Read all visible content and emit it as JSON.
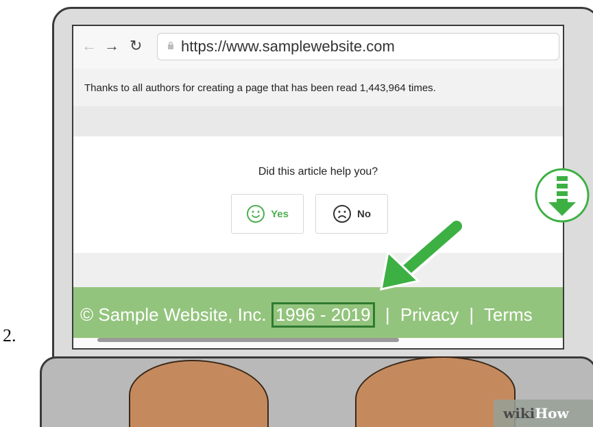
{
  "step_number": "2.",
  "browser": {
    "url": "https://www.samplewebsite.com"
  },
  "page": {
    "read_count_text": "Thanks to all authors for creating a page that has been read 1,443,964 times.",
    "feedback_question": "Did this article help you?",
    "yes_label": "Yes",
    "no_label": "No"
  },
  "footer": {
    "copyright": "© Sample Website, Inc.",
    "years": "1996 - 2019",
    "separator": "|",
    "privacy_label": "Privacy",
    "terms_label": "Terms"
  },
  "watermark": {
    "part1": "wiki",
    "part2": "How"
  },
  "colors": {
    "footer_green": "#93c47d",
    "accent_green": "#4caf50",
    "highlight_border": "#2f7a2f"
  }
}
